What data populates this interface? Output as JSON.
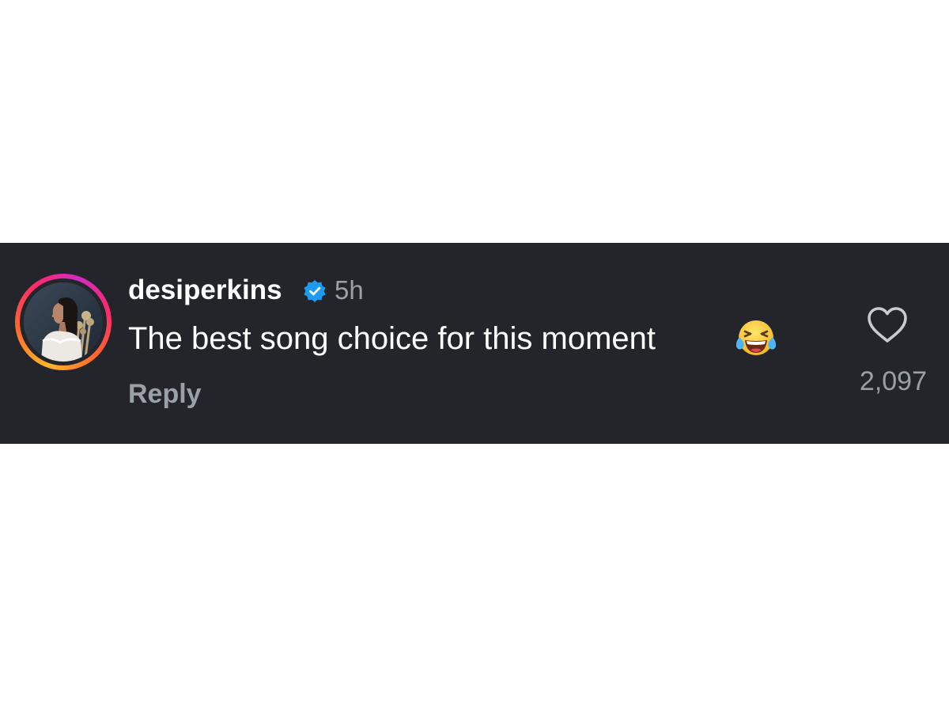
{
  "comment": {
    "username": "desiperkins",
    "verified": true,
    "timestamp": "5h",
    "text": "The best song choice for this moment",
    "emoji": "face-with-tears-of-joy",
    "reply_label": "Reply",
    "like_count": "2,097"
  },
  "colors": {
    "background": "#23252b",
    "primary_text": "#ffffff",
    "secondary_text": "#9aa0a8",
    "verified_badge": "#1d9bf0"
  },
  "icons": {
    "verified": "verified-badge-icon",
    "like": "heart-outline-icon"
  }
}
